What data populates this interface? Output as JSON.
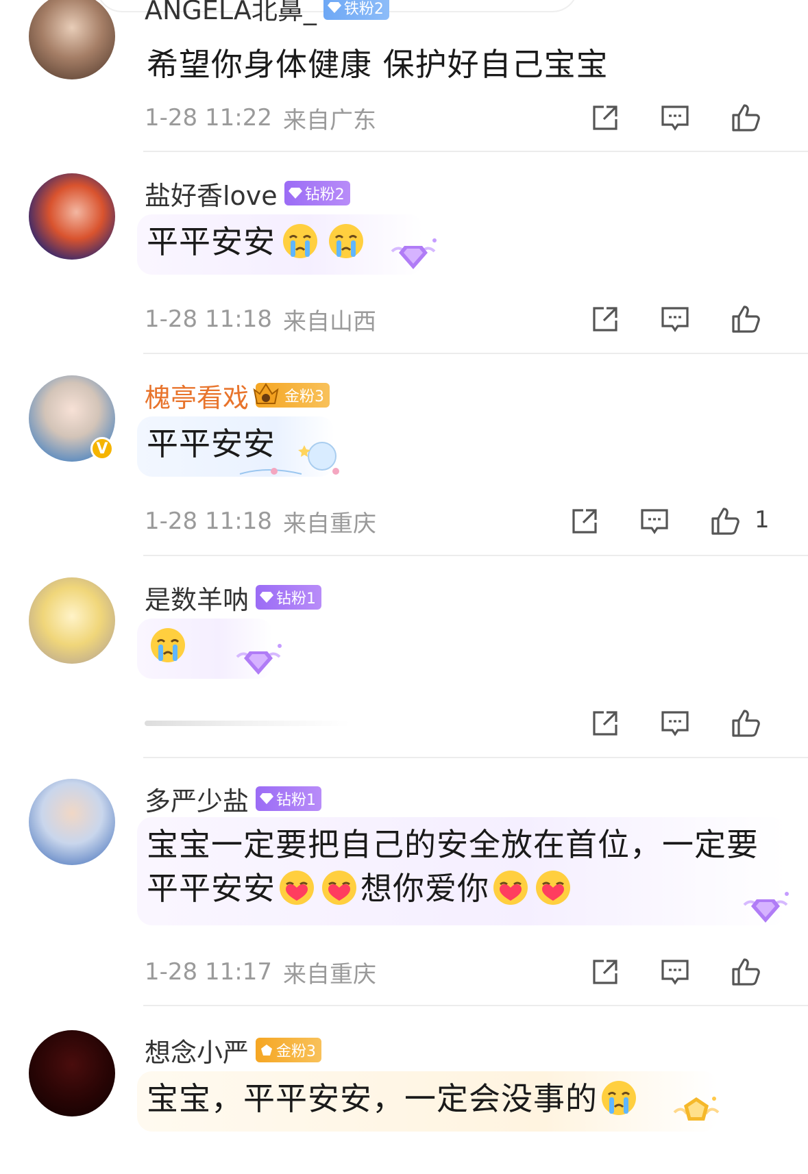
{
  "comments": [
    {
      "username": "ANGELA北鼻_",
      "badge": {
        "label": "铁粉2",
        "style": "blue"
      },
      "text": "希望你身体健康 保护好自己宝宝",
      "time": "1-28 11:22",
      "location": "来自广东",
      "likes": ""
    },
    {
      "username": "盐好香love",
      "badge": {
        "label": "钻粉2",
        "style": "purple"
      },
      "text": "平平安安",
      "emojis": [
        "crying-emoji",
        "crying-emoji"
      ],
      "time": "1-28 11:18",
      "location": "来自山西",
      "likes": ""
    },
    {
      "username": "槐亭看戏",
      "verified": true,
      "badge": {
        "label": "金粉3",
        "style": "gold"
      },
      "text": "平平安安",
      "time": "1-28 11:18",
      "location": "来自重庆",
      "likes": "1"
    },
    {
      "username": "是数羊呐",
      "badge": {
        "label": "钻粉1",
        "style": "purple"
      },
      "text": "",
      "emojis": [
        "crying-emoji"
      ],
      "time": "",
      "location": "",
      "likes": ""
    },
    {
      "username": "多严少盐",
      "badge": {
        "label": "钻粉1",
        "style": "purple"
      },
      "text_line1": "宝宝一定要把自己的安全放在首位，一定要",
      "text_line2a": "平平安安",
      "text_line2b": "想你爱你",
      "emojis": [
        "heart-hug-emoji",
        "heart-hug-emoji",
        "heart-hug-emoji",
        "heart-hug-emoji"
      ],
      "time": "1-28 11:17",
      "location": "来自重庆",
      "likes": ""
    },
    {
      "username": "想念小严",
      "badge": {
        "label": "金粉3",
        "style": "gold"
      },
      "text": "宝宝，平平安安，一定会没事的",
      "emojis": [
        "crying-emoji"
      ],
      "time": "",
      "location": "",
      "likes": ""
    }
  ],
  "colors": {
    "meta": "#9a9a9a",
    "divider": "#ececec",
    "gold_username": "#e8742c",
    "purple_badge": "#9b6cf5",
    "gold_badge": "#f5a623",
    "icon_stroke": "#555555"
  },
  "icons": {
    "repost": "share-external-icon",
    "comment": "comment-bubble-icon",
    "like": "thumbs-up-icon"
  }
}
